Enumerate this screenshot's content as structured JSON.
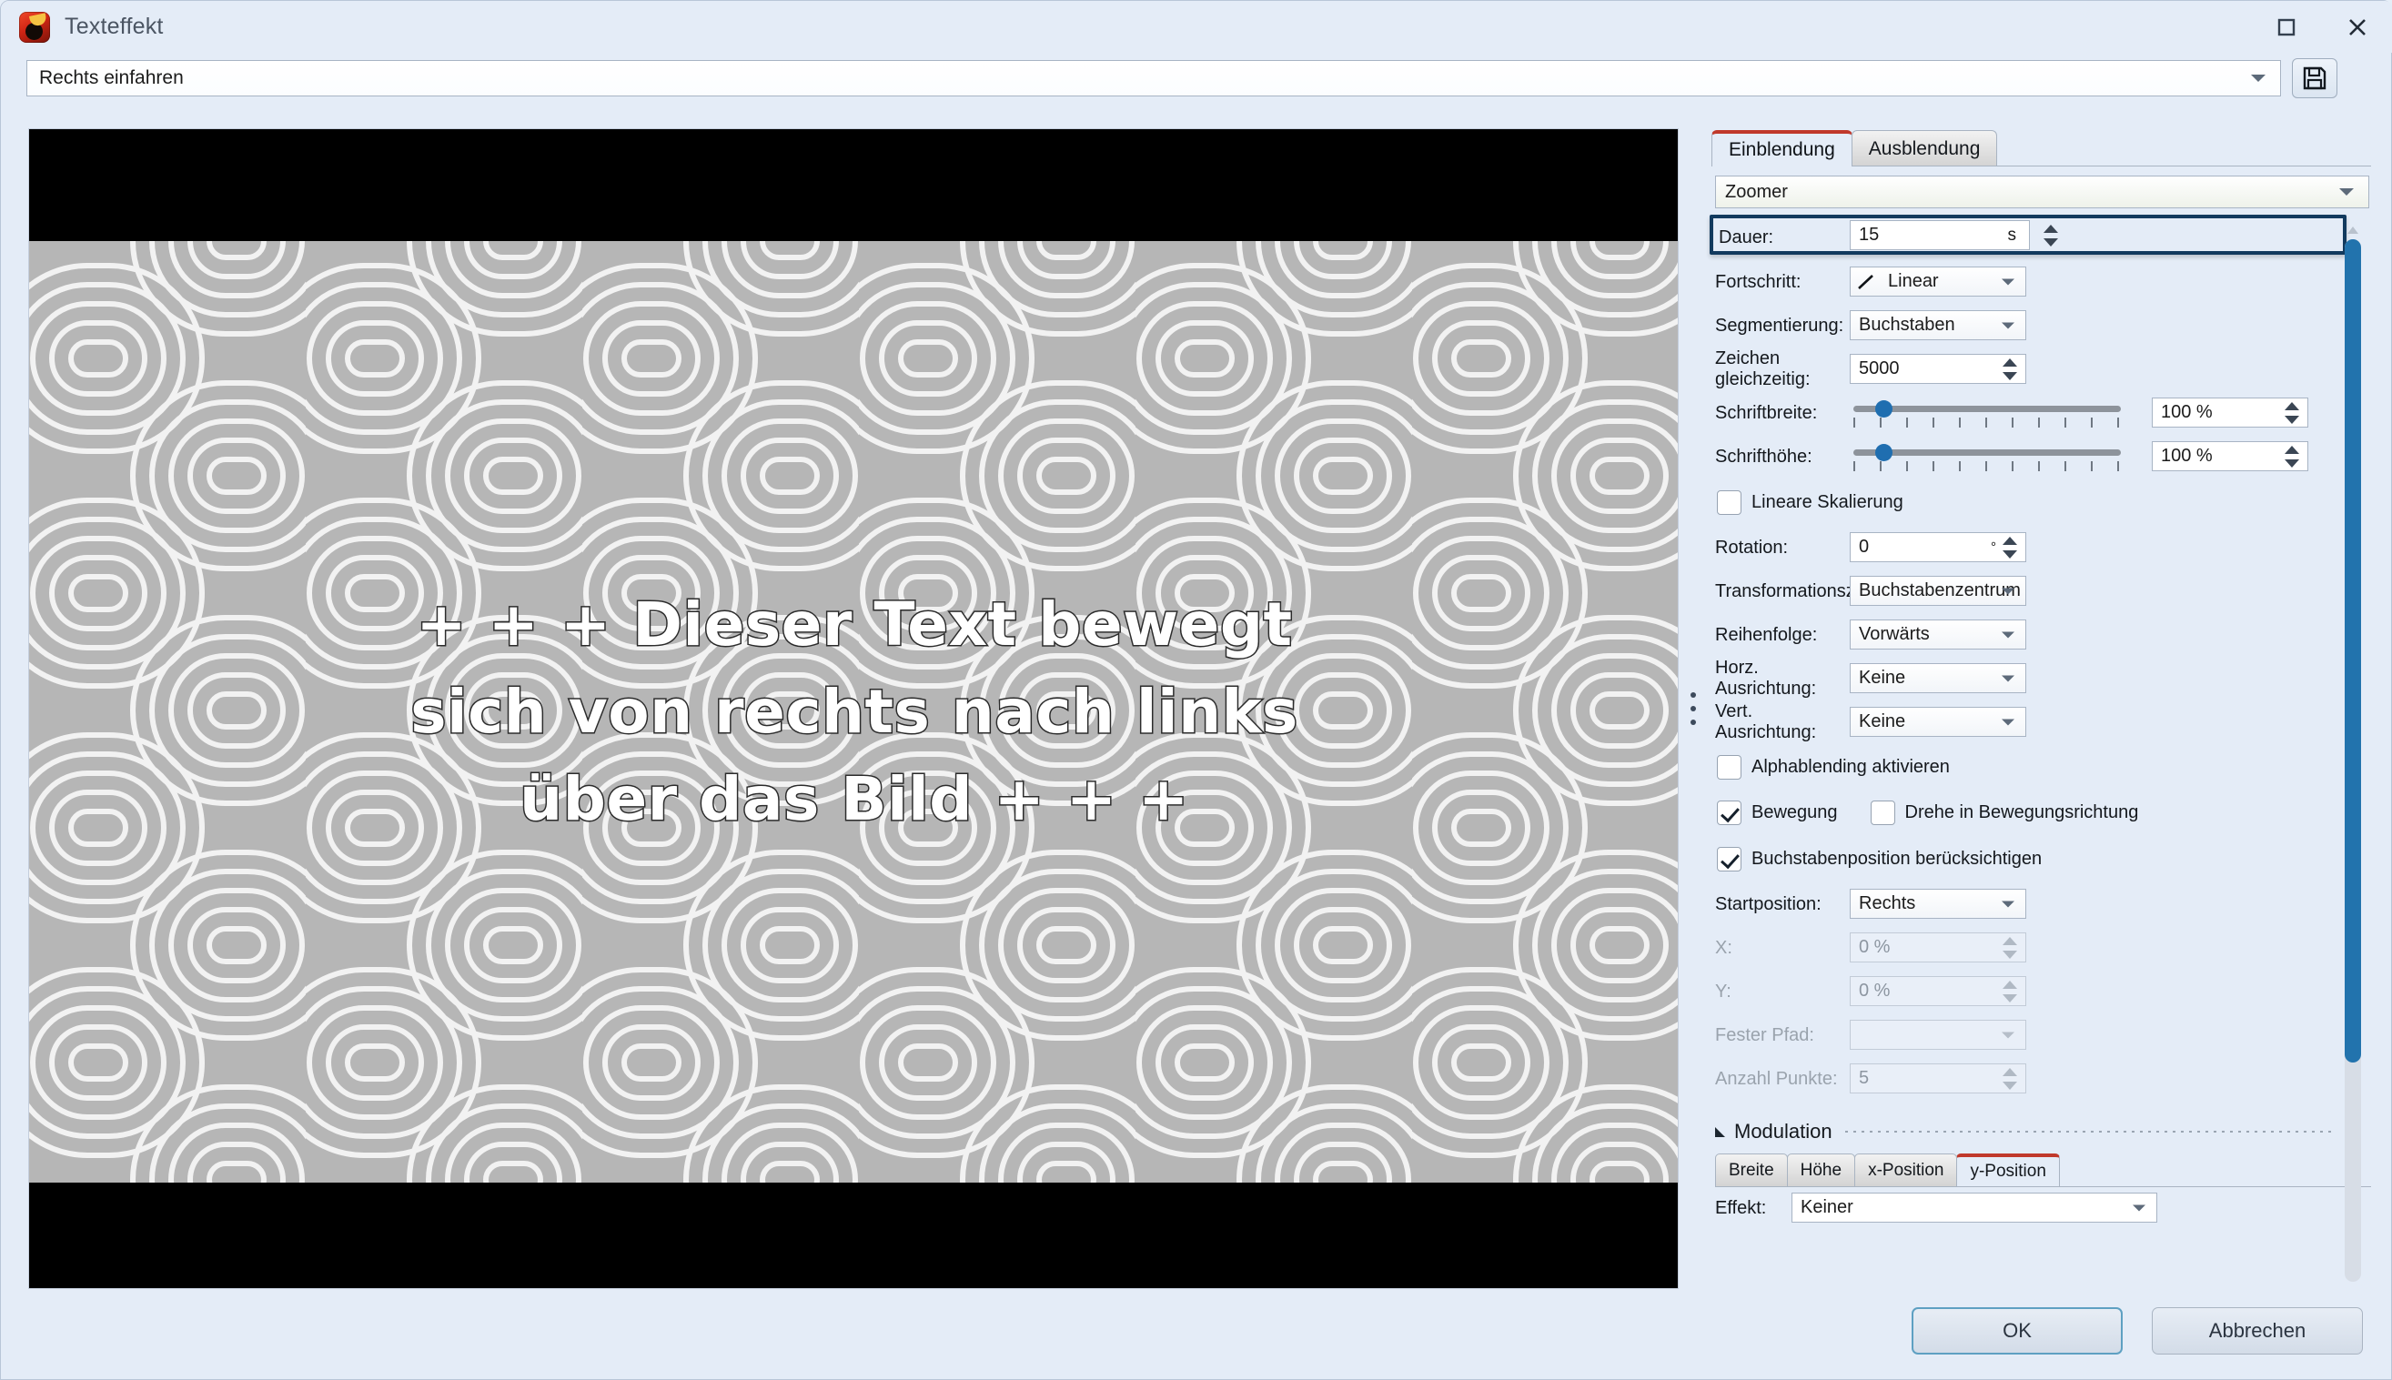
{
  "window": {
    "title": "Texteffekt",
    "icon": "app-icon",
    "maximize_glyph": "□",
    "close_glyph": "✕"
  },
  "preset": {
    "value": "Rechts einfahren",
    "save_icon": "floppy-disk-icon"
  },
  "preview": {
    "lines": [
      "+ + + Dieser Text bewegt",
      "sich von rechts nach links",
      "über das Bild + + +"
    ]
  },
  "panel": {
    "tabs": [
      {
        "label": "Einblendung",
        "active": true
      },
      {
        "label": "Ausblendung",
        "active": false
      }
    ],
    "effect_type": "Zoomer",
    "fields": {
      "dauer": {
        "label": "Dauer:",
        "value": "15",
        "unit": "s",
        "highlighted": true
      },
      "fortschritt": {
        "label": "Fortschritt:",
        "value": "Linear"
      },
      "segmentierung": {
        "label": "Segmentierung:",
        "value": "Buchstaben"
      },
      "zeichen": {
        "label": "Zeichen gleichzeitig:",
        "value": "5000"
      },
      "schriftbreite": {
        "label": "Schriftbreite:",
        "value": "100 %",
        "slider_percent": 10
      },
      "schrifthoehe": {
        "label": "Schrifthöhe:",
        "value": "100 %",
        "slider_percent": 10
      },
      "lineare_skalierung": {
        "label": "Lineare Skalierung",
        "checked": false
      },
      "rotation": {
        "label": "Rotation:",
        "value": "0",
        "unit": "°"
      },
      "transformationszentrum": {
        "label": "Transformationszentrum:",
        "value": "Buchstabenzentrum"
      },
      "reihenfolge": {
        "label": "Reihenfolge:",
        "value": "Vorwärts"
      },
      "horz_ausrichtung": {
        "label": "Horz. Ausrichtung:",
        "value": "Keine"
      },
      "vert_ausrichtung": {
        "label": "Vert. Ausrichtung:",
        "value": "Keine"
      },
      "alphablending": {
        "label": "Alphablending aktivieren",
        "checked": false
      },
      "bewegung": {
        "label": "Bewegung",
        "checked": true
      },
      "drehe": {
        "label": "Drehe in Bewegungsrichtung",
        "checked": false
      },
      "buchstabenposition": {
        "label": "Buchstabenposition berücksichtigen",
        "checked": true
      },
      "startposition": {
        "label": "Startposition:",
        "value": "Rechts"
      },
      "x": {
        "label": "X:",
        "value": "0 %",
        "disabled": true
      },
      "y": {
        "label": "Y:",
        "value": "0 %",
        "disabled": true
      },
      "fester_pfad": {
        "label": "Fester Pfad:",
        "value": "",
        "disabled": true
      },
      "anzahl_punkte": {
        "label": "Anzahl Punkte:",
        "value": "5",
        "disabled": true
      }
    },
    "modulation": {
      "title": "Modulation",
      "tabs": [
        {
          "label": "Breite",
          "active": false
        },
        {
          "label": "Höhe",
          "active": false
        },
        {
          "label": "x-Position",
          "active": false
        },
        {
          "label": "y-Position",
          "active": true
        }
      ],
      "effekt_label": "Effekt:",
      "effekt_value": "Keiner"
    }
  },
  "footer": {
    "ok_label": "OK",
    "cancel_label": "Abbrechen"
  },
  "colors": {
    "accent_red": "#c0392b",
    "highlight_border": "#123a5e",
    "scrollbar": "#2273ad",
    "slider_thumb": "#1f6eb0",
    "window_bg": "#e4ecf7"
  }
}
